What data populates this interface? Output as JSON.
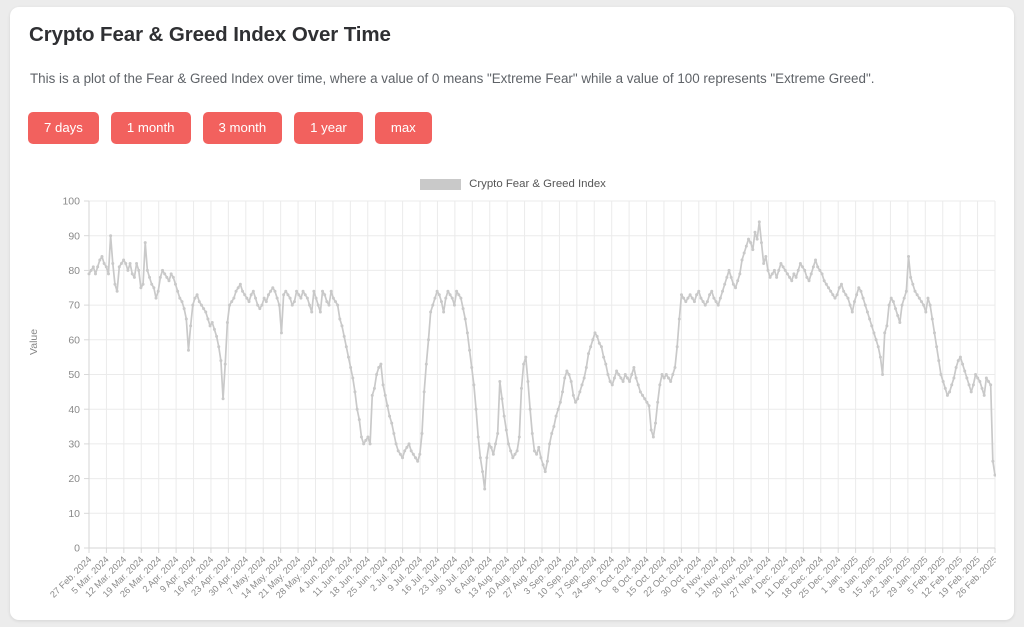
{
  "header": {
    "title": "Crypto Fear & Greed Index Over Time",
    "description": "This is a plot of the Fear & Greed Index over time, where a value of 0 means \"Extreme Fear\" while a value of 100 represents \"Extreme Greed\"."
  },
  "colors": {
    "button": "#f2615e",
    "button_text": "#ffffff",
    "card": "#ffffff",
    "page_background": "#ececec",
    "series_line": "#c9c9c9",
    "grid": "#ebebeb",
    "axis_text": "#8a8a8a"
  },
  "range_buttons": [
    {
      "label": "7 days",
      "name": "range-7-days"
    },
    {
      "label": "1 month",
      "name": "range-1-month"
    },
    {
      "label": "3 month",
      "name": "range-3-month"
    },
    {
      "label": "1 year",
      "name": "range-1-year"
    },
    {
      "label": "max",
      "name": "range-max"
    }
  ],
  "chart_data": {
    "type": "line",
    "title": "",
    "xlabel": "",
    "ylabel": "Value",
    "ylim": [
      0,
      100
    ],
    "yticks": [
      0,
      10,
      20,
      30,
      40,
      50,
      60,
      70,
      80,
      90,
      100
    ],
    "grid": true,
    "legend_position": "top-center",
    "legend": [
      "Crypto Fear & Greed Index"
    ],
    "series_name": "Crypto Fear & Greed Index",
    "xtick_labels": [
      "27 Feb. 2024",
      "5 Mar. 2024",
      "12 Mar. 2024",
      "19 Mar. 2024",
      "26 Mar. 2024",
      "2 Apr. 2024",
      "9 Apr. 2024",
      "16 Apr. 2024",
      "23 Apr. 2024",
      "30 Apr. 2024",
      "7 May. 2024",
      "14 May. 2024",
      "21 May. 2024",
      "28 May. 2024",
      "4 Jun. 2024",
      "11 Jun. 2024",
      "18 Jun. 2024",
      "25 Jun. 2024",
      "2 Jul. 2024",
      "9 Jul. 2024",
      "16 Jul. 2024",
      "23 Jul. 2024",
      "30 Jul. 2024",
      "6 Aug. 2024",
      "13 Aug. 2024",
      "20 Aug. 2024",
      "27 Aug. 2024",
      "3 Sep. 2024",
      "10 Sep. 2024",
      "17 Sep. 2024",
      "24 Sep. 2024",
      "1 Oct. 2024",
      "8 Oct. 2024",
      "15 Oct. 2024",
      "22 Oct. 2024",
      "30 Oct. 2024",
      "6 Nov. 2024",
      "13 Nov. 2024",
      "20 Nov. 2024",
      "27 Nov. 2024",
      "4 Dec. 2024",
      "11 Dec. 2024",
      "18 Dec. 2024",
      "25 Dec. 2024",
      "1 Jan. 2025",
      "8 Jan. 2025",
      "15 Jan. 2025",
      "22 Jan. 2025",
      "29 Jan. 2025",
      "5 Feb. 2025",
      "12 Feb. 2025",
      "19 Feb. 2025",
      "26 Feb. 2025"
    ],
    "x_start_date": "27 Feb. 2024",
    "x_end_date": "26 Feb. 2025",
    "sampling": "daily",
    "values": [
      79,
      80,
      81,
      79,
      81,
      83,
      84,
      82,
      81,
      79,
      90,
      82,
      76,
      74,
      81,
      82,
      83,
      82,
      80,
      82,
      79,
      78,
      82,
      80,
      75,
      76,
      88,
      80,
      78,
      76,
      75,
      72,
      74,
      78,
      80,
      79,
      78,
      77,
      79,
      78,
      76,
      74,
      72,
      71,
      69,
      66,
      57,
      64,
      70,
      72,
      73,
      71,
      70,
      69,
      68,
      66,
      64,
      65,
      63,
      61,
      58,
      54,
      43,
      53,
      65,
      70,
      71,
      72,
      74,
      75,
      76,
      74,
      73,
      72,
      71,
      73,
      74,
      72,
      70,
      69,
      70,
      72,
      71,
      73,
      74,
      75,
      74,
      72,
      70,
      62,
      73,
      74,
      73,
      72,
      70,
      71,
      74,
      73,
      72,
      74,
      73,
      72,
      70,
      68,
      74,
      72,
      70,
      68,
      74,
      73,
      71,
      70,
      74,
      72,
      71,
      70,
      66,
      64,
      61,
      58,
      55,
      52,
      49,
      45,
      40,
      37,
      32,
      30,
      31,
      32,
      30,
      44,
      46,
      50,
      52,
      53,
      47,
      44,
      41,
      38,
      36,
      33,
      30,
      28,
      27,
      26,
      28,
      29,
      30,
      28,
      27,
      26,
      25,
      27,
      33,
      45,
      53,
      60,
      68,
      70,
      72,
      74,
      73,
      71,
      68,
      72,
      74,
      73,
      72,
      70,
      74,
      73,
      72,
      69,
      66,
      62,
      57,
      52,
      47,
      40,
      32,
      26,
      22,
      17,
      26,
      30,
      29,
      27,
      30,
      33,
      48,
      43,
      38,
      34,
      30,
      28,
      26,
      27,
      28,
      32,
      46,
      53,
      55,
      48,
      40,
      33,
      28,
      27,
      29,
      26,
      24,
      22,
      25,
      30,
      33,
      35,
      38,
      40,
      42,
      45,
      49,
      51,
      50,
      48,
      44,
      42,
      43,
      45,
      47,
      49,
      52,
      56,
      58,
      60,
      62,
      61,
      59,
      58,
      55,
      53,
      50,
      48,
      47,
      49,
      51,
      50,
      49,
      48,
      50,
      49,
      48,
      50,
      52,
      49,
      47,
      45,
      44,
      43,
      42,
      41,
      34,
      32,
      36,
      42,
      47,
      50,
      49,
      50,
      49,
      48,
      50,
      52,
      58,
      66,
      73,
      72,
      71,
      72,
      73,
      72,
      71,
      73,
      74,
      72,
      71,
      70,
      71,
      73,
      74,
      72,
      71,
      70,
      72,
      74,
      76,
      78,
      80,
      78,
      76,
      75,
      77,
      79,
      83,
      85,
      87,
      89,
      88,
      86,
      91,
      89,
      94,
      88,
      82,
      84,
      80,
      78,
      79,
      80,
      78,
      80,
      82,
      81,
      80,
      79,
      78,
      77,
      79,
      78,
      80,
      82,
      81,
      80,
      78,
      77,
      79,
      81,
      83,
      81,
      80,
      79,
      77,
      76,
      75,
      74,
      73,
      72,
      73,
      75,
      76,
      74,
      73,
      72,
      70,
      68,
      71,
      73,
      75,
      74,
      72,
      70,
      68,
      66,
      64,
      62,
      60,
      58,
      55,
      50,
      62,
      64,
      70,
      72,
      71,
      69,
      67,
      65,
      70,
      72,
      74,
      84,
      78,
      76,
      74,
      73,
      72,
      71,
      70,
      68,
      72,
      70,
      66,
      62,
      58,
      54,
      50,
      48,
      46,
      44,
      45,
      47,
      49,
      52,
      54,
      55,
      53,
      51,
      49,
      47,
      45,
      47,
      50,
      49,
      48,
      46,
      44,
      49,
      48,
      47,
      25,
      21
    ]
  }
}
